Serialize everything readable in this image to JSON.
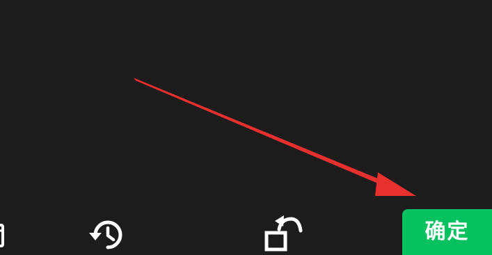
{
  "toolbar": {
    "confirm_label": "确定",
    "icons": {
      "history": "history-icon",
      "rotate": "rotate-icon",
      "edge": "edge-tool-icon"
    },
    "confirm_color": "#08c160"
  },
  "annotation": {
    "arrow_color": "#e8302f"
  },
  "colors": {
    "background": "#1c1c1c",
    "icon": "#ffffff"
  }
}
